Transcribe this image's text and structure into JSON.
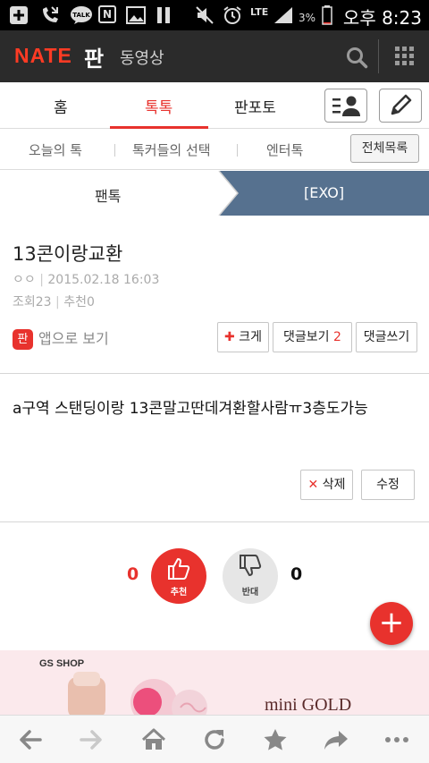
{
  "status_bar": {
    "talk_icon_label": "TALK",
    "news_icon_label": "N",
    "network": "LTE",
    "battery": "3%",
    "time": "오후 8:23"
  },
  "app_header": {
    "logo": "NATE",
    "section": "판",
    "video_link": "동영상"
  },
  "tabs": [
    {
      "label": "홈",
      "active": false
    },
    {
      "label": "톡톡",
      "active": true
    },
    {
      "label": "판포토",
      "active": false
    }
  ],
  "subtabs": [
    "오늘의 톡",
    "톡커들의 선택",
    "엔터톡"
  ],
  "full_list_button": "전체목록",
  "breadcrumb": {
    "parent": "팬톡",
    "current": "[EXO]"
  },
  "post": {
    "title": "13콘이랑교환",
    "author": "ㅇㅇ",
    "date": "2015.02.18 16:03",
    "views_label": "조회",
    "views": "23",
    "recommend_label": "추천",
    "recommend": "0",
    "app_badge": "판",
    "app_view_label": "앱으로 보기",
    "enlarge_button": "크게",
    "comments_view_label": "댓글보기",
    "comments_count": "2",
    "write_comment_button": "댓글쓰기",
    "content": "a구역 스탠딩이랑 13콘말고딴데겨환할사람ㅠ3층도가능",
    "delete_button": "삭제",
    "edit_button": "수정"
  },
  "votes": {
    "up_count": "0",
    "up_label": "추천",
    "down_count": "0",
    "down_label": "반대"
  },
  "fab_label": "+",
  "ad": {
    "brand": "GS SHOP",
    "product": "mini GOLD"
  },
  "colors": {
    "accent_red": "#e8322d",
    "header_bg": "#2b2b2b",
    "breadcrumb_blue": "#56718f"
  },
  "icons": {
    "header": [
      "search-icon",
      "grid-menu-icon"
    ],
    "tools": [
      "profile-list-icon",
      "pencil-icon"
    ],
    "bottom_nav": [
      "back-arrow-icon",
      "forward-arrow-icon",
      "home-icon",
      "refresh-icon",
      "star-icon",
      "share-icon",
      "more-icon"
    ]
  }
}
